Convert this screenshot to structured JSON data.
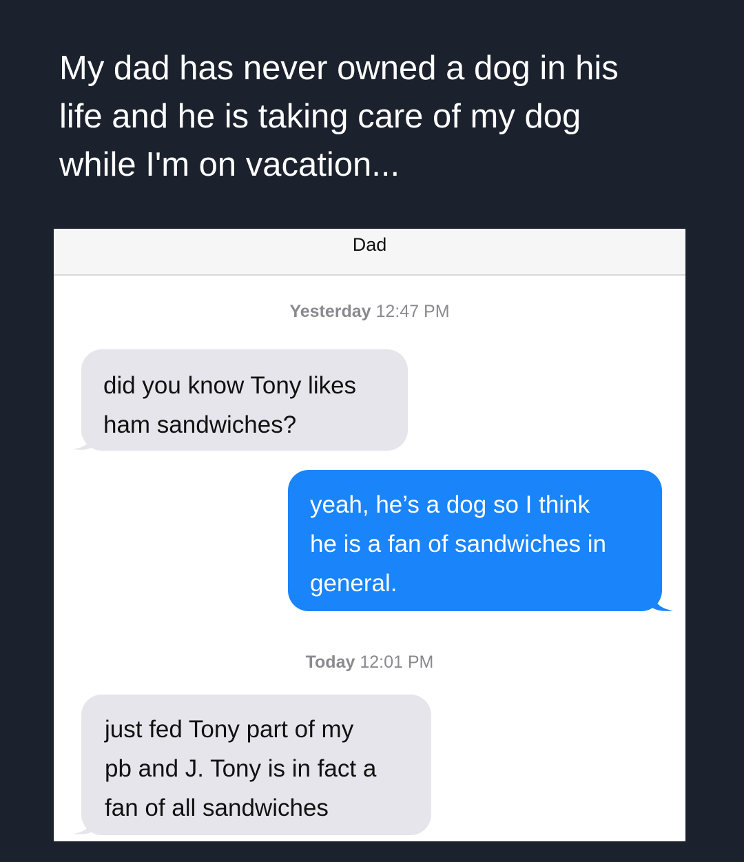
{
  "caption": "My dad has never owned a dog in his\nlife and he is taking care of my dog\nwhile I'm on vacation...",
  "conversation": {
    "contact_name": "Dad",
    "groups": [
      {
        "day": "Yesterday",
        "time": "12:47 PM"
      },
      {
        "day": "Today",
        "time": "12:01 PM"
      }
    ],
    "messages": [
      {
        "direction": "incoming",
        "text": "did you know Tony likes\nham sandwiches?"
      },
      {
        "direction": "outgoing",
        "text": "yeah, he’s a dog so I think\nhe is a fan of sandwiches in\ngeneral."
      },
      {
        "direction": "incoming",
        "text": "just fed Tony part of my\npb and J. Tony is in fact a\nfan of all sandwiches"
      }
    ]
  },
  "colors": {
    "page_background": "#1b222d",
    "incoming_bubble": "#e6e5eb",
    "outgoing_bubble": "#1a84fb",
    "timestamp_text": "#8a8a8e"
  }
}
